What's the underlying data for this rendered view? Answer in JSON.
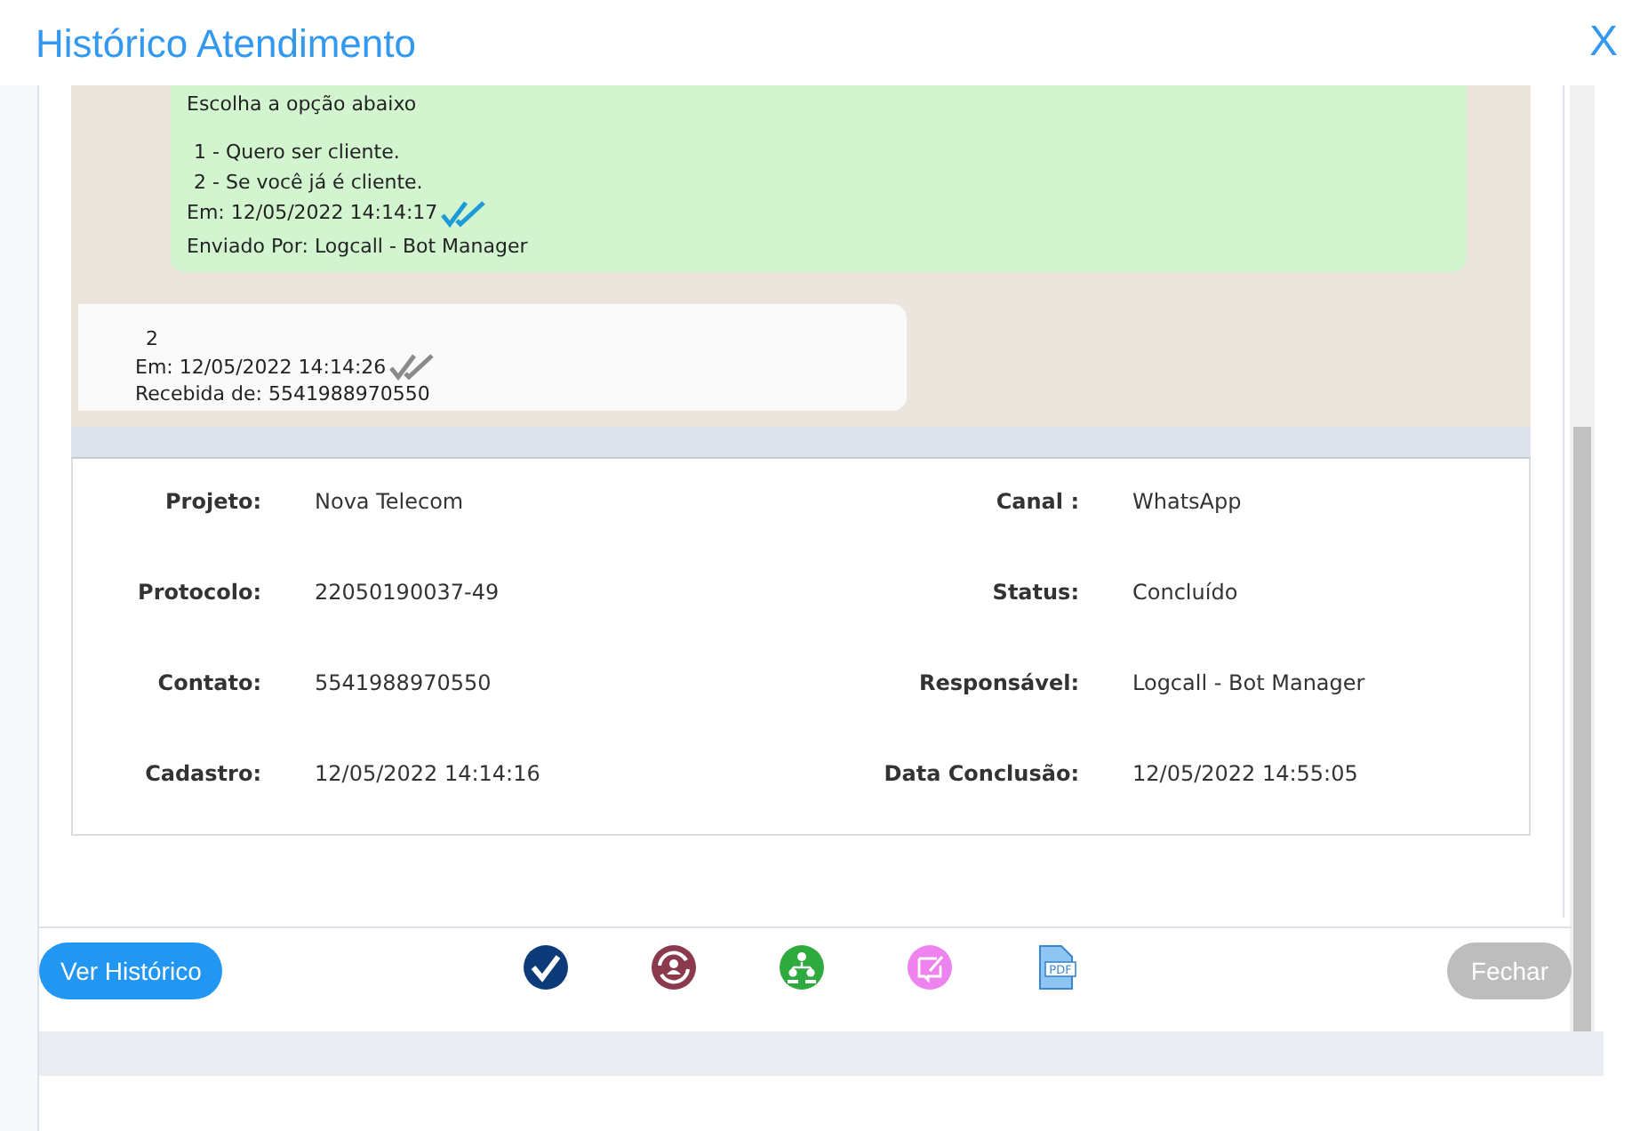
{
  "window": {
    "title": "Histórico Atendimento",
    "close": "X"
  },
  "messages": [
    {
      "kind": "sent",
      "lines": [
        "Escolha a opção abaixo",
        "1 - Quero ser cliente.",
        "2 - Se você já é cliente."
      ],
      "time": "Em: 12/05/2022 14:14:17",
      "read": true,
      "footer": "Enviado Por: Logcall - Bot Manager"
    },
    {
      "kind": "received",
      "lines": [
        "2"
      ],
      "time": "Em: 12/05/2022 14:14:26",
      "read": false,
      "footer": "Recebida de: 5541988970550"
    }
  ],
  "details": [
    {
      "label": "Projeto:",
      "value": "Nova Telecom"
    },
    {
      "label": "Canal :",
      "value": "WhatsApp"
    },
    {
      "label": "Protocolo:",
      "value": "22050190037-49"
    },
    {
      "label": "Status:",
      "value": "Concluído"
    },
    {
      "label": "Contato:",
      "value": "5541988970550"
    },
    {
      "label": "Responsável:",
      "value": "Logcall - Bot Manager"
    },
    {
      "label": "Cadastro:",
      "value": "12/05/2022 14:14:16"
    },
    {
      "label": "Data Conclusão:",
      "value": "12/05/2022 14:55:05"
    }
  ],
  "footer": {
    "history_button": "Ver Histórico",
    "actions": [
      {
        "kind": "check"
      },
      {
        "kind": "transfer"
      },
      {
        "kind": "team"
      },
      {
        "kind": "note"
      },
      {
        "kind": "pdf",
        "label": "PDF"
      }
    ],
    "close_button": {
      "label": "Fechar",
      "disabled": true
    }
  }
}
